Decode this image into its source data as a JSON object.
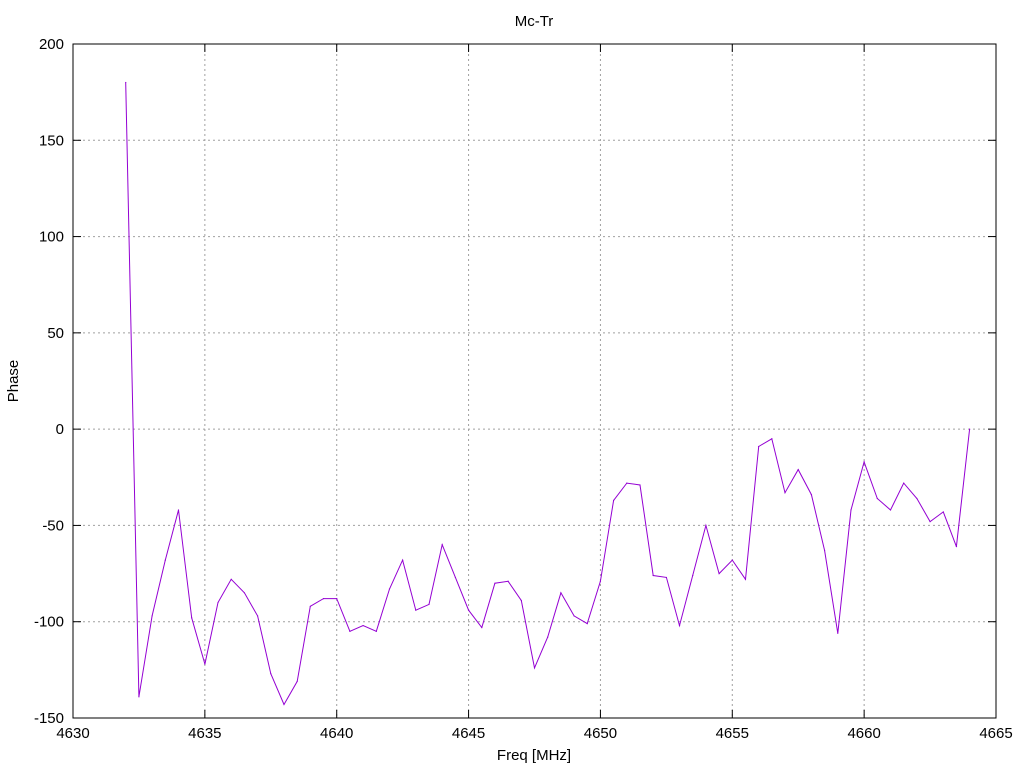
{
  "chart_data": {
    "type": "line",
    "title": "Mc-Tr",
    "xlabel": "Freq [MHz]",
    "ylabel": "Phase",
    "xlim": [
      4630,
      4665
    ],
    "ylim": [
      -150,
      200
    ],
    "x_ticks": [
      4630,
      4635,
      4640,
      4645,
      4650,
      4655,
      4660,
      4665
    ],
    "y_ticks": [
      -150,
      -100,
      -50,
      0,
      50,
      100,
      150,
      200
    ],
    "grid": true,
    "grid_style": "dotted",
    "series": [
      {
        "color": "#9400d3",
        "points": [
          [
            4632.0,
            180
          ],
          [
            4632.5,
            -139
          ],
          [
            4633.0,
            -97
          ],
          [
            4633.5,
            -68
          ],
          [
            4634.0,
            -42
          ],
          [
            4634.5,
            -98
          ],
          [
            4635.0,
            -122
          ],
          [
            4635.5,
            -90
          ],
          [
            4636.0,
            -78
          ],
          [
            4636.5,
            -85
          ],
          [
            4637.0,
            -97
          ],
          [
            4637.5,
            -127
          ],
          [
            4638.0,
            -143
          ],
          [
            4638.5,
            -131
          ],
          [
            4639.0,
            -92
          ],
          [
            4639.5,
            -88
          ],
          [
            4640.0,
            -88
          ],
          [
            4640.5,
            -105
          ],
          [
            4641.0,
            -102
          ],
          [
            4641.5,
            -105
          ],
          [
            4642.0,
            -83
          ],
          [
            4642.5,
            -68
          ],
          [
            4643.0,
            -94
          ],
          [
            4643.5,
            -91
          ],
          [
            4644.0,
            -60
          ],
          [
            4644.5,
            -77
          ],
          [
            4645.0,
            -94
          ],
          [
            4645.5,
            -103
          ],
          [
            4646.0,
            -80
          ],
          [
            4646.5,
            -79
          ],
          [
            4647.0,
            -89
          ],
          [
            4647.5,
            -124
          ],
          [
            4648.0,
            -108
          ],
          [
            4648.5,
            -85
          ],
          [
            4649.0,
            -97
          ],
          [
            4649.5,
            -101
          ],
          [
            4650.0,
            -79
          ],
          [
            4650.5,
            -37
          ],
          [
            4651.0,
            -28
          ],
          [
            4651.5,
            -29
          ],
          [
            4652.0,
            -76
          ],
          [
            4652.5,
            -77
          ],
          [
            4653.0,
            -102
          ],
          [
            4653.5,
            -76
          ],
          [
            4654.0,
            -50
          ],
          [
            4654.5,
            -75
          ],
          [
            4655.0,
            -68
          ],
          [
            4655.5,
            -78
          ],
          [
            4656.0,
            -9
          ],
          [
            4656.5,
            -5
          ],
          [
            4657.0,
            -33
          ],
          [
            4657.5,
            -21
          ],
          [
            4658.0,
            -34
          ],
          [
            4658.5,
            -63
          ],
          [
            4659.0,
            -106
          ],
          [
            4659.5,
            -42
          ],
          [
            4660.0,
            -17
          ],
          [
            4660.5,
            -36
          ],
          [
            4661.0,
            -42
          ],
          [
            4661.5,
            -28
          ],
          [
            4662.0,
            -36
          ],
          [
            4662.5,
            -48
          ],
          [
            4663.0,
            -43
          ],
          [
            4663.5,
            -61
          ],
          [
            4664.0,
            0
          ]
        ]
      }
    ]
  }
}
